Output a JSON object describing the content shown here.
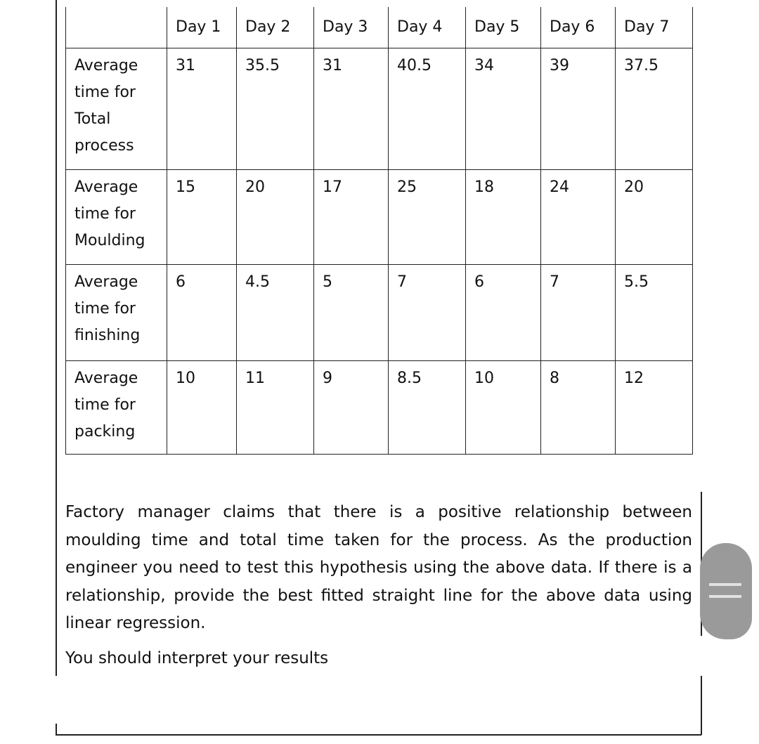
{
  "table": {
    "headers": [
      "",
      "Day 1",
      "Day 2",
      "Day 3",
      "Day 4",
      "Day 5",
      "Day 6",
      "Day 7"
    ],
    "rows": [
      {
        "label": [
          "Average",
          "time for",
          "Total",
          "process"
        ],
        "values": [
          "31",
          "35.5",
          "31",
          "40.5",
          "34",
          "39",
          "37.5"
        ]
      },
      {
        "label": [
          "Average",
          "time for",
          "Moulding"
        ],
        "values": [
          "15",
          "20",
          "17",
          "25",
          "18",
          "24",
          "20"
        ]
      },
      {
        "label": [
          "Average",
          "time for",
          "finishing"
        ],
        "values": [
          "6",
          "4.5",
          "5",
          "7",
          "6",
          "7",
          "5.5"
        ]
      },
      {
        "label": [
          "Average",
          "time for",
          "packing"
        ],
        "values": [
          "10",
          "11",
          "9",
          "8.5",
          "10",
          "8",
          "12"
        ]
      }
    ]
  },
  "question": {
    "paragraph": "Factory manager claims that there is a positive relationship between moulding time and total time taken for the process. As the production engineer you need to test this hypothesis using the above data. If there is a relationship, provide the best fitted straight line for the above data using linear regression.",
    "instruction": "You should interpret your results"
  },
  "scroll_handle": {
    "icon": "drag-handle-icon",
    "color": "#9a9a9a"
  }
}
